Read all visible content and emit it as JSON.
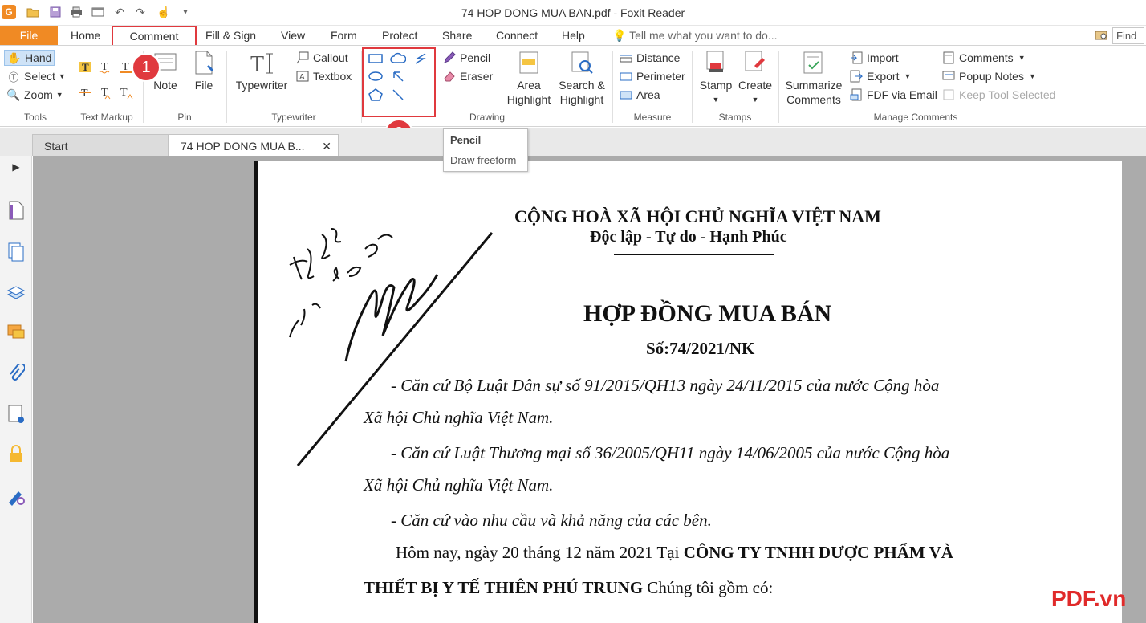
{
  "window": {
    "title": "74 HOP DONG MUA BAN.pdf - Foxit Reader"
  },
  "menu_tabs": {
    "file": "File",
    "home": "Home",
    "comment": "Comment",
    "fill_sign": "Fill & Sign",
    "view": "View",
    "form": "Form",
    "protect": "Protect",
    "share": "Share",
    "connect": "Connect",
    "help": "Help"
  },
  "tell_me": "Tell me what you want to do...",
  "find": "Find",
  "ribbon": {
    "tools": {
      "hand": "Hand",
      "select": "Select",
      "zoom": "Zoom",
      "label": "Tools"
    },
    "text_markup": {
      "label": "Text Markup"
    },
    "pin": {
      "note": "Note",
      "file": "File",
      "label": "Pin"
    },
    "typewriter": {
      "typewriter": "Typewriter",
      "callout": "Callout",
      "textbox": "Textbox",
      "label": "Typewriter"
    },
    "drawing": {
      "pencil": "Pencil",
      "eraser": "Eraser",
      "area_highlight_1": "Area",
      "area_highlight_2": "Highlight",
      "search_highlight_1": "Search &",
      "search_highlight_2": "Highlight",
      "label": "Drawing"
    },
    "measure": {
      "distance": "Distance",
      "perimeter": "Perimeter",
      "area": "Area",
      "label": "Measure"
    },
    "stamps": {
      "stamp": "Stamp",
      "create": "Create",
      "label": "Stamps"
    },
    "manage": {
      "summarize_1": "Summarize",
      "summarize_2": "Comments",
      "import": "Import",
      "export": "Export",
      "fdf_email": "FDF via Email",
      "comments": "Comments",
      "popup_notes": "Popup Notes",
      "keep_tool": "Keep Tool Selected",
      "label": "Manage Comments"
    }
  },
  "badges": {
    "one": "1",
    "two": "2"
  },
  "tooltip": {
    "title": "Pencil",
    "description": "Draw freeform"
  },
  "doc_tabs": {
    "start": "Start",
    "active": "74 HOP DONG MUA B..."
  },
  "document": {
    "national": "CỘNG HOÀ XÃ HỘI CHỦ NGHĨA VIỆT NAM",
    "motto": "Độc lập - Tự do - Hạnh Phúc",
    "title": "HỢP ĐỒNG MUA BÁN",
    "number": "Số:74/2021/NK",
    "line1a": "- Căn cứ Bộ Luật Dân sự số 91/2015/QH13 ngày 24/11/2015 của nước Cộng hòa",
    "line1b": "Xã hội Chủ nghĩa Việt Nam.",
    "line2a": "- Căn cứ Luật Thương mại số 36/2005/QH11 ngày 14/06/2005 của nước Cộng hòa",
    "line2b": "Xã hội Chủ nghĩa Việt Nam.",
    "line3": "- Căn cứ vào nhu cầu và khả năng của các bên.",
    "line4a": "Hôm nay, ngày 20 tháng 12 năm 2021  Tại ",
    "line4b": "CÔNG TY TNHH DƯỢC PHẨM VÀ",
    "line5a": "THIẾT BỊ Y TẾ THIÊN PHÚ TRUNG",
    "line5b": "  Chúng tôi gồm có:"
  },
  "watermark": "PDF.vn",
  "colors": {
    "accent_orange": "#f08a24",
    "highlight_red": "#e0393e",
    "watermark_red": "#e02a2a"
  }
}
